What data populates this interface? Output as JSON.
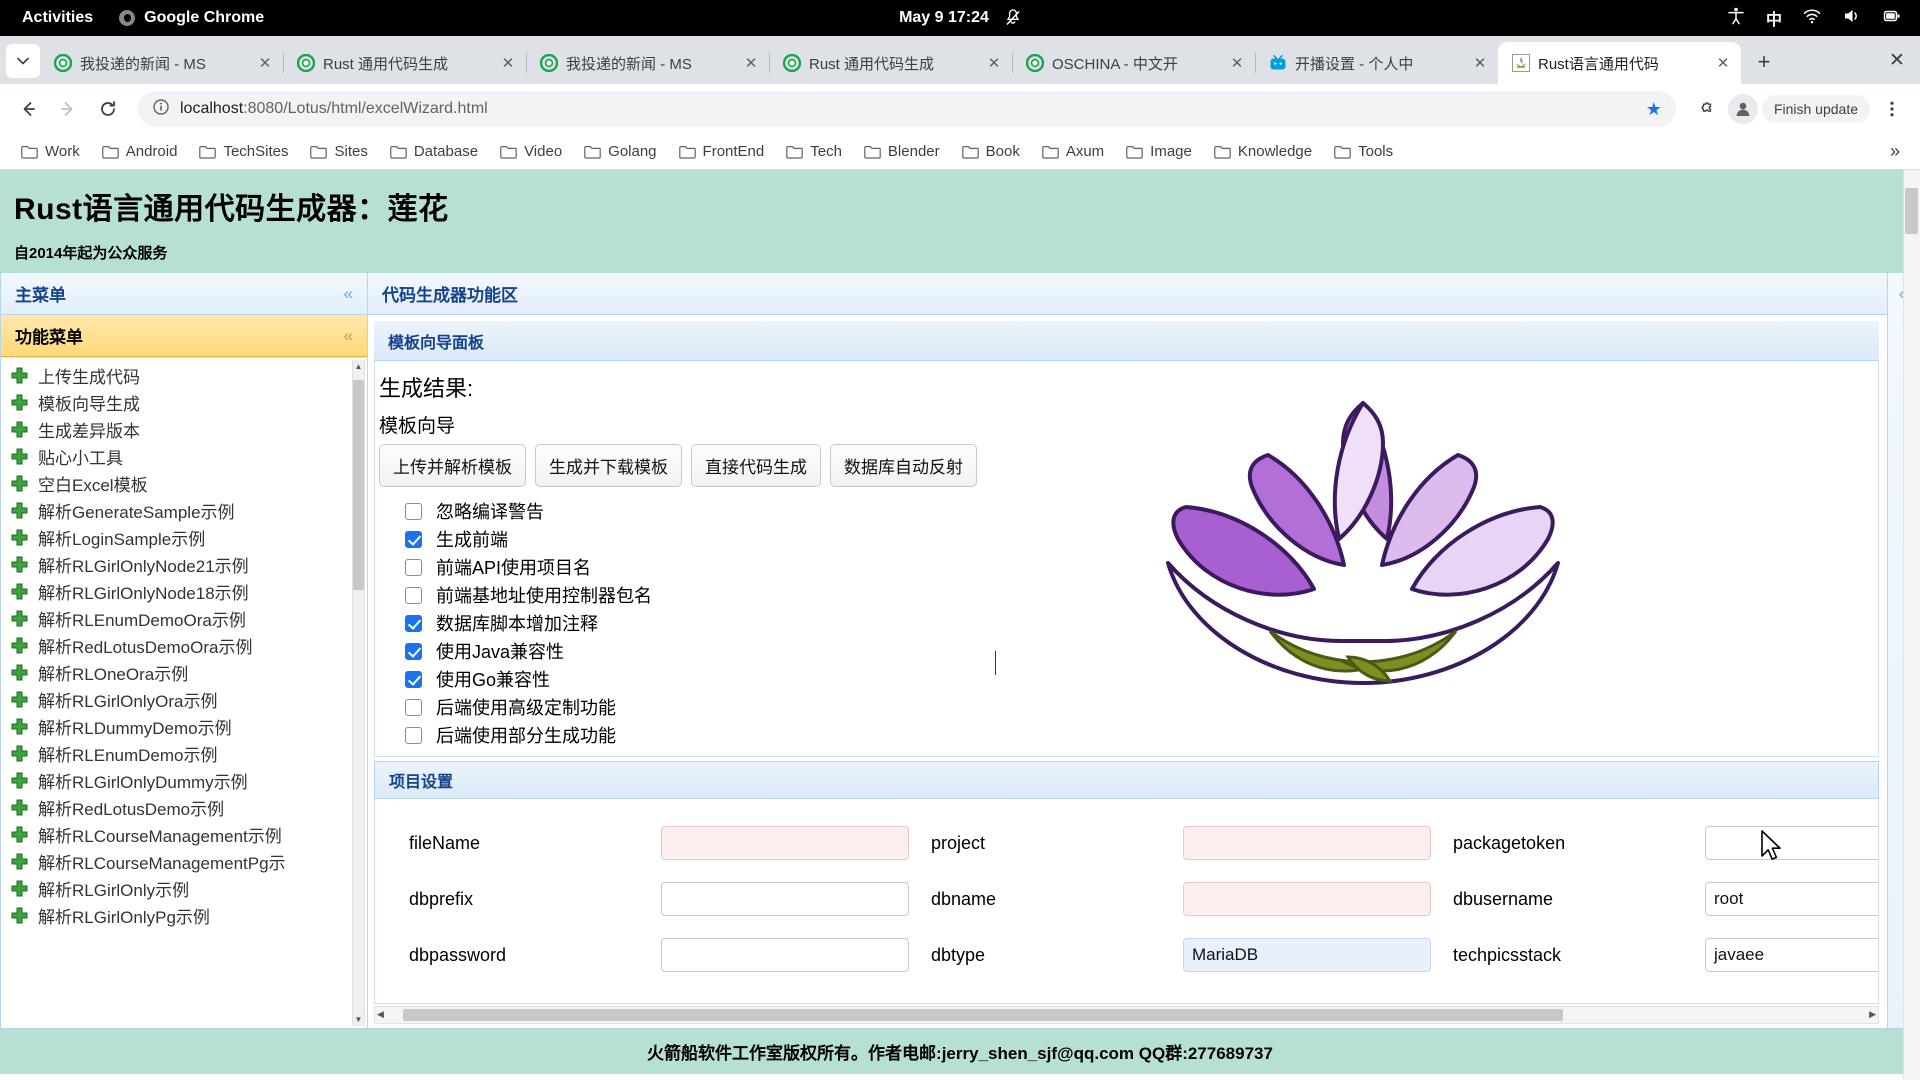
{
  "system_bar": {
    "activities": "Activities",
    "app_name": "Google Chrome",
    "clock": "May 9  17:24",
    "icons": [
      "bell-muted-icon",
      "accessibility-icon",
      "input-method-icon",
      "wifi-icon",
      "volume-icon",
      "power-icon"
    ],
    "input_method": "中"
  },
  "browser": {
    "tabs": [
      {
        "title": "我投递的新闻 - MS",
        "favicon": "chrome-icon",
        "active": false
      },
      {
        "title": "Rust 通用代码生成",
        "favicon": "chrome-icon",
        "active": false
      },
      {
        "title": "我投递的新闻 - MS",
        "favicon": "chrome-icon",
        "active": false
      },
      {
        "title": "Rust 通用代码生成",
        "favicon": "chrome-icon",
        "active": false
      },
      {
        "title": "OSCHINA - 中文开",
        "favicon": "chrome-icon",
        "active": false
      },
      {
        "title": "开播设置 - 个人中",
        "favicon": "bilibili-icon",
        "active": false
      },
      {
        "title": "Rust语言通用代码",
        "favicon": "lotus-icon",
        "active": true
      }
    ],
    "new_tab_label": "+",
    "close_window_label": "✕",
    "tab_close_label": "✕",
    "omnibox": {
      "host": "localhost",
      "path": ":8080/Lotus/html/excelWizard.html",
      "info_icon": "info-circle-icon",
      "star_icon": "bookmark-star-icon",
      "extensions_icon": "puzzle-icon",
      "profile_icon": "profile-avatar-icon",
      "menu_icon": "three-dots-icon"
    },
    "update_button": "Finish update",
    "nav": {
      "back": "back-arrow-icon",
      "forward": "forward-arrow-icon",
      "reload": "reload-icon"
    },
    "bookmarks": [
      "Work",
      "Android",
      "TechSites",
      "Sites",
      "Database",
      "Video",
      "Golang",
      "FrontEnd",
      "Tech",
      "Blender",
      "Book",
      "Axum",
      "Image",
      "Knowledge",
      "Tools"
    ],
    "bookmarks_overflow": "»"
  },
  "page": {
    "banner": {
      "title": "Rust语言通用代码生成器：莲花",
      "subtitle": "自2014年起为公众服务"
    },
    "sidebar": {
      "main_menu_title": "主菜单",
      "main_menu_chevron": "«",
      "function_menu_title": "功能菜单",
      "function_menu_chevron": "«",
      "items": [
        "上传生成代码",
        "模板向导生成",
        "生成差异版本",
        "贴心小工具",
        "空白Excel模板",
        "解析GenerateSample示例",
        "解析LoginSample示例",
        "解析RLGirlOnlyNode21示例",
        "解析RLGirlOnlyNode18示例",
        "解析RLEnumDemoOra示例",
        "解析RedLotusDemoOra示例",
        "解析RLOneOra示例",
        "解析RLGirlOnlyOra示例",
        "解析RLDummyDemo示例",
        "解析RLEnumDemo示例",
        "解析RLGirlOnlyDummy示例",
        "解析RedLotusDemo示例",
        "解析RLCourseManagement示例",
        "解析RLCourseManagementPg示",
        "解析RLGirlOnly示例",
        "解析RLGirlOnlyPg示例"
      ]
    },
    "main": {
      "panel_title": "代码生成器功能区",
      "wizard_panel_title": "模板向导面板",
      "result_label": "生成结果:",
      "wizard_label": "模板向导",
      "buttons": [
        "上传并解析模板",
        "生成并下载模板",
        "直接代码生成",
        "数据库自动反射"
      ],
      "checkboxes": [
        {
          "label": "忽略编译警告",
          "checked": false
        },
        {
          "label": "生成前端",
          "checked": true
        },
        {
          "label": "前端API使用项目名",
          "checked": false
        },
        {
          "label": "前端基地址使用控制器包名",
          "checked": false
        },
        {
          "label": "数据库脚本增加注释",
          "checked": true
        },
        {
          "label": "使用Java兼容性",
          "checked": true
        },
        {
          "label": "使用Go兼容性",
          "checked": true
        },
        {
          "label": "后端使用高级定制功能",
          "checked": false
        },
        {
          "label": "后端使用部分生成功能",
          "checked": false
        }
      ],
      "logo_alt": "lotus-flower-logo",
      "project_settings_title": "项目设置",
      "fields": [
        [
          {
            "label": "fileName",
            "value": "",
            "style": "pink"
          },
          {
            "label": "project",
            "value": "",
            "style": "pink"
          },
          {
            "label": "packagetoken",
            "value": "",
            "style": "plain"
          }
        ],
        [
          {
            "label": "dbprefix",
            "value": "",
            "style": "plain"
          },
          {
            "label": "dbname",
            "value": "",
            "style": "pink"
          },
          {
            "label": "dbusername",
            "value": "root",
            "style": "plain"
          }
        ],
        [
          {
            "label": "dbpassword",
            "value": "",
            "style": "plain"
          },
          {
            "label": "dbtype",
            "value": "MariaDB",
            "style": "sel"
          },
          {
            "label": "techpicsstack",
            "value": "javaee",
            "style": "plain"
          }
        ]
      ],
      "collapse_right_chevron": "«"
    },
    "footer": "火箭船软件工作室版权所有。作者电邮:jerry_shen_sjf@qq.com QQ群:277689737"
  },
  "colors": {
    "banner_bg": "#b6e0d4",
    "panel_header": "#15428b",
    "accordion_bg": "#ffd878",
    "accent": "#1a73e8"
  }
}
